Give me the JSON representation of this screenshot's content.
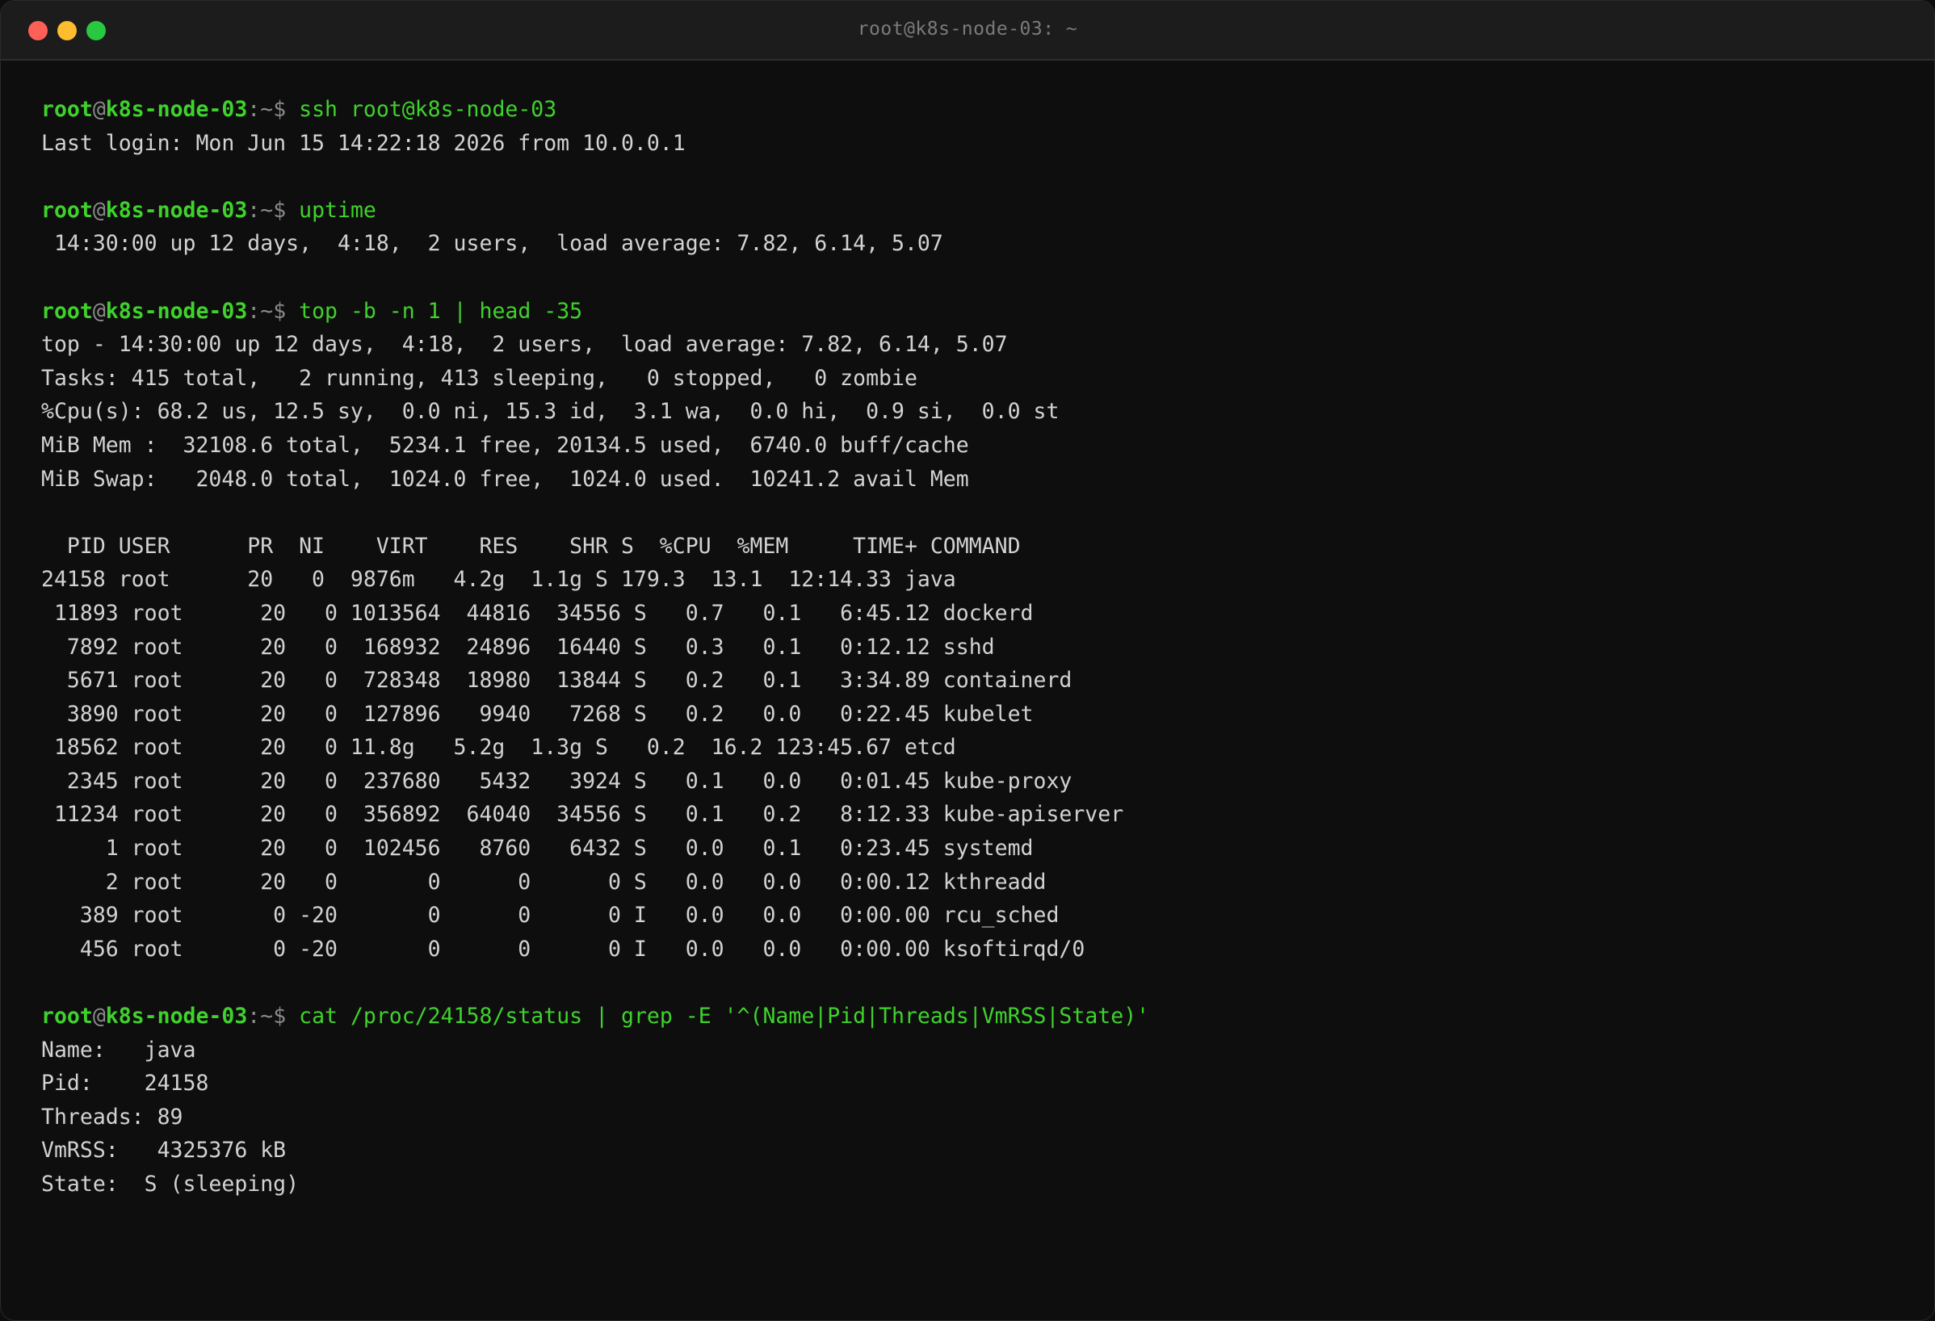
{
  "window": {
    "title": "root@k8s-node-03: ~"
  },
  "prompt": {
    "user": "root",
    "at": "@",
    "host": "k8s-node-03",
    "sep": ":~$ "
  },
  "blocks": [
    {
      "command": "ssh root@k8s-node-03",
      "output": [
        "Last login: Mon Jun 15 14:22:18 2026 from 10.0.0.1"
      ]
    },
    {
      "command": "uptime",
      "output": [
        " 14:30:00 up 12 days,  4:18,  2 users,  load average: 7.82, 6.14, 5.07"
      ]
    },
    {
      "command": "top -b -n 1 | head -35",
      "output": [
        "top - 14:30:00 up 12 days,  4:18,  2 users,  load average: 7.82, 6.14, 5.07",
        "Tasks: 415 total,   2 running, 413 sleeping,   0 stopped,   0 zombie",
        "%Cpu(s): 68.2 us, 12.5 sy,  0.0 ni, 15.3 id,  3.1 wa,  0.0 hi,  0.9 si,  0.0 st",
        "MiB Mem :  32108.6 total,  5234.1 free, 20134.5 used,  6740.0 buff/cache",
        "MiB Swap:   2048.0 total,  1024.0 free,  1024.0 used.  10241.2 avail Mem",
        "",
        "  PID USER      PR  NI    VIRT    RES    SHR S  %CPU  %MEM     TIME+ COMMAND",
        "24158 root      20   0  9876m   4.2g  1.1g S 179.3  13.1  12:14.33 java",
        " 11893 root      20   0 1013564  44816  34556 S   0.7   0.1   6:45.12 dockerd",
        "  7892 root      20   0  168932  24896  16440 S   0.3   0.1   0:12.12 sshd",
        "  5671 root      20   0  728348  18980  13844 S   0.2   0.1   3:34.89 containerd",
        "  3890 root      20   0  127896   9940   7268 S   0.2   0.0   0:22.45 kubelet",
        " 18562 root      20   0 11.8g   5.2g  1.3g S   0.2  16.2 123:45.67 etcd",
        "  2345 root      20   0  237680   5432   3924 S   0.1   0.0   0:01.45 kube-proxy",
        " 11234 root      20   0  356892  64040  34556 S   0.1   0.2   8:12.33 kube-apiserver",
        "     1 root      20   0  102456   8760   6432 S   0.0   0.1   0:23.45 systemd",
        "     2 root      20   0       0      0      0 S   0.0   0.0   0:00.12 kthreadd",
        "   389 root       0 -20       0      0      0 I   0.0   0.0   0:00.00 rcu_sched",
        "   456 root       0 -20       0      0      0 I   0.0   0.0   0:00.00 ksoftirqd/0"
      ]
    },
    {
      "command": "cat /proc/24158/status | grep -E '^(Name|Pid|Threads|VmRSS|State)'",
      "output": [
        "Name:   java",
        "Pid:    24158",
        "Threads: 89",
        "VmRSS:   4325376 kB",
        "State:  S (sleeping)"
      ]
    }
  ]
}
